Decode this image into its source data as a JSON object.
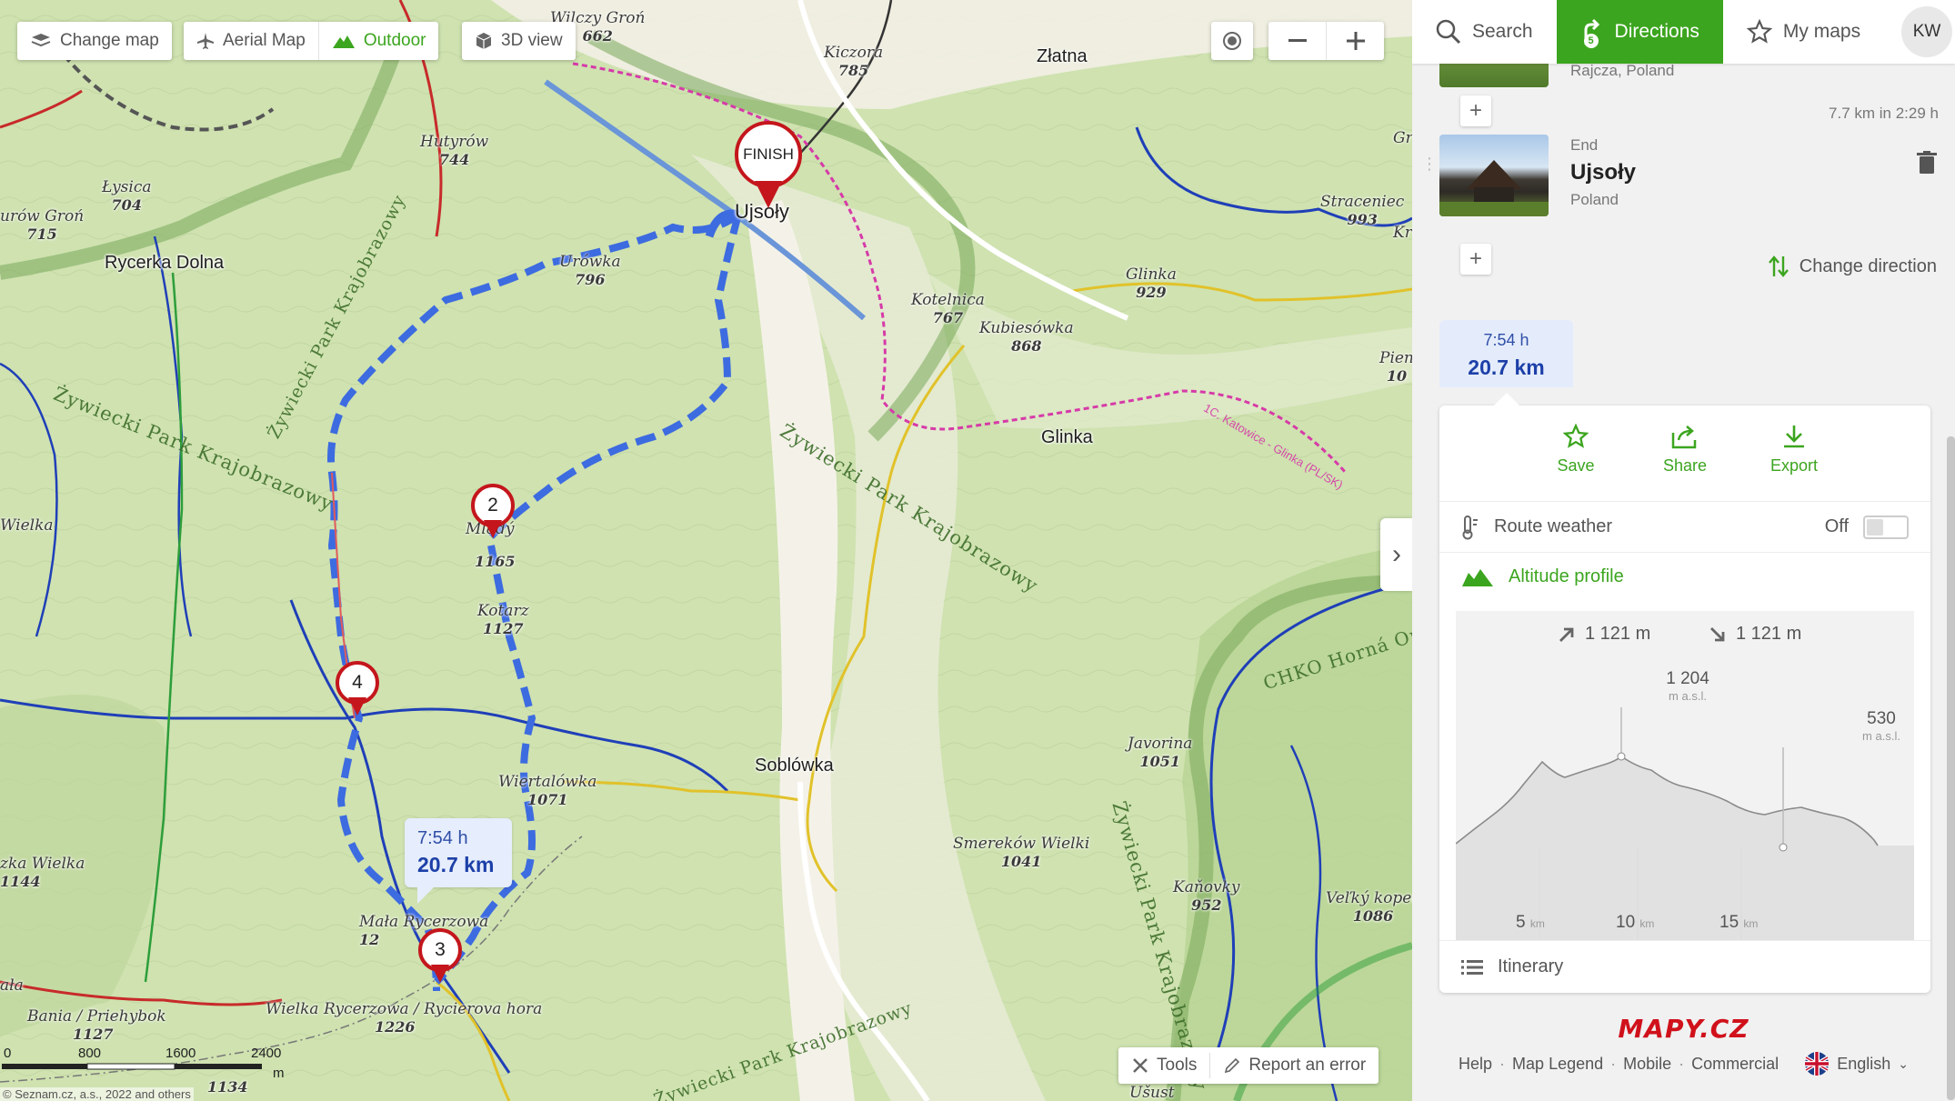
{
  "map_controls": {
    "change_map": "Change map",
    "aerial_map": "Aerial Map",
    "outdoor": "Outdoor",
    "view_3d": "3D view",
    "tools": "Tools",
    "report_error": "Report an error"
  },
  "map_labels": {
    "towns": [
      "Rycerka Dolna",
      "Ujsoły",
      "Złatna",
      "Glinka",
      "Soblówka"
    ],
    "peaks": [
      {
        "name": "Wilczy Groń",
        "height": "662"
      },
      {
        "name": "Kiczora",
        "height": "785"
      },
      {
        "name": "Hutyrów",
        "height": "744"
      },
      {
        "name": "Łysica",
        "height": "704"
      },
      {
        "name": "urów Groń",
        "height": "715"
      },
      {
        "name": "Urówka",
        "height": "796"
      },
      {
        "name": "Kotelnica",
        "height": "767"
      },
      {
        "name": "Kubiesówka",
        "height": "868"
      },
      {
        "name": "Glinka",
        "height": "929"
      },
      {
        "name": "Straceniec",
        "height": "993"
      },
      {
        "name": "Kotarz",
        "height": "1127"
      },
      {
        "name": "1165"
      },
      {
        "name": "Wiertalówka",
        "height": "1071"
      },
      {
        "name": "Javorina",
        "height": "1051"
      },
      {
        "name": "Smereków Wielki",
        "height": "1041"
      },
      {
        "name": "Kaňovky",
        "height": "952"
      },
      {
        "name": "Veľký kopec",
        "height": "1086"
      },
      {
        "name": "Mała Rycerzowa",
        "height": "12"
      },
      {
        "name": "Wielka Rycerzowa / Rycierova hora",
        "height": "1226"
      },
      {
        "name": "zka Wielka",
        "height": "1144"
      },
      {
        "name": "Bania / Priehybok",
        "height": "1127"
      },
      {
        "name": "1134"
      },
      {
        "name": "Wielka"
      },
      {
        "name": "ała"
      },
      {
        "name": "Gr"
      },
      {
        "name": "Kr"
      },
      {
        "name": "Pien",
        "height": "10"
      },
      {
        "name": "Mladý"
      },
      {
        "name": "Ušust"
      }
    ],
    "parks": [
      "Żywiecki Park Krajobrazowy",
      "Żywiecki Park Krajobrazowy",
      "Żywiecki Park Krajobrazowy",
      "Żywiecki Park Krajobrazowy",
      "Żywiecki Park Krajobrazowy",
      "CHKO Horná Or"
    ],
    "trail": "1C. Katowice - Glinka (PL/SK)",
    "scale_ticks": [
      "0",
      "800",
      "1600",
      "2400",
      "m"
    ],
    "copyright": "© Seznam.cz, a.s., 2022 and others"
  },
  "pins": {
    "finish": "FINISH",
    "p2": "2",
    "p3": "3",
    "p4": "4"
  },
  "route_bubble": {
    "time": "7:54 h",
    "distance": "20.7 km"
  },
  "tabs": {
    "search": "Search",
    "directions": "Directions",
    "my_maps": "My maps",
    "directions_badge": "5",
    "avatar": "KW"
  },
  "stops": {
    "prev_place": "Rajcza, Poland",
    "leg": "7.7 km in 2:29 h",
    "end_label": "End",
    "end_name": "Ujsoły",
    "end_country": "Poland",
    "change_direction": "Change direction"
  },
  "summary": {
    "time": "7:54 h",
    "distance": "20.7 km"
  },
  "actions": {
    "save": "Save",
    "share": "Share",
    "export": "Export"
  },
  "route_weather": {
    "label": "Route weather",
    "state": "Off"
  },
  "altitude": {
    "label": "Altitude profile",
    "ascent": "1 121 m",
    "descent": "1 121 m",
    "max": "1 204",
    "max_unit": "m a.s.l.",
    "end": "530",
    "end_unit": "m a.s.l.",
    "ticks": [
      "5",
      "10",
      "15"
    ],
    "tick_unit": "km"
  },
  "itinerary": "Itinerary",
  "footer": {
    "logo": "MAPY.CZ",
    "links": [
      "Help",
      "Map Legend",
      "Mobile",
      "Commercial"
    ],
    "language": "English"
  },
  "colors": {
    "accent_green": "#3ca51f",
    "route_blue": "#3d6be0",
    "pin_red": "#c4161c"
  }
}
